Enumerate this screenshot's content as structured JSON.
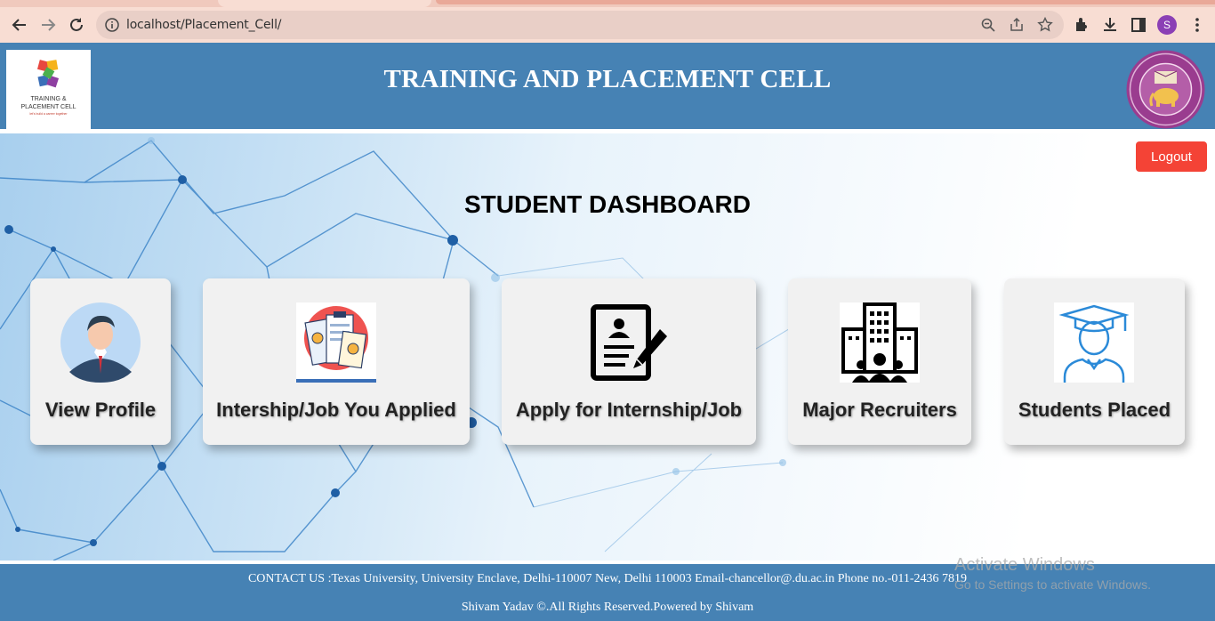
{
  "browser": {
    "url": "localhost/Placement_Cell/",
    "profile_initial": "S"
  },
  "header": {
    "title": "TRAINING AND PLACEMENT CELL",
    "logo_line1": "TRAINING &",
    "logo_line2": "PLACEMENT CELL",
    "logo_tagline": "let's build a career together"
  },
  "main": {
    "logout_label": "Logout",
    "dashboard_title": "STUDENT DASHBOARD",
    "cards": [
      {
        "label": "View Profile"
      },
      {
        "label": "Intership/Job You Applied"
      },
      {
        "label": "Apply for Internship/Job"
      },
      {
        "label": "Major Recruiters"
      },
      {
        "label": "Students Placed"
      }
    ]
  },
  "footer": {
    "contact": "CONTACT US :Texas University, University Enclave, Delhi-110007 New, Delhi 110003  Email-chancellor@.du.ac.in  Phone no.-011-2436 7819",
    "copyright": "Shivam Yadav ©.All Rights Reserved.Powered by Shivam"
  },
  "os_watermark": {
    "line1": "Activate Windows",
    "line2": "Go to Settings to activate Windows."
  },
  "colors": {
    "header_bg": "#4682b4",
    "logout_bg": "#f44336",
    "card_bg": "#f1f1f1",
    "browser_toolbar": "#f8ddd3"
  }
}
